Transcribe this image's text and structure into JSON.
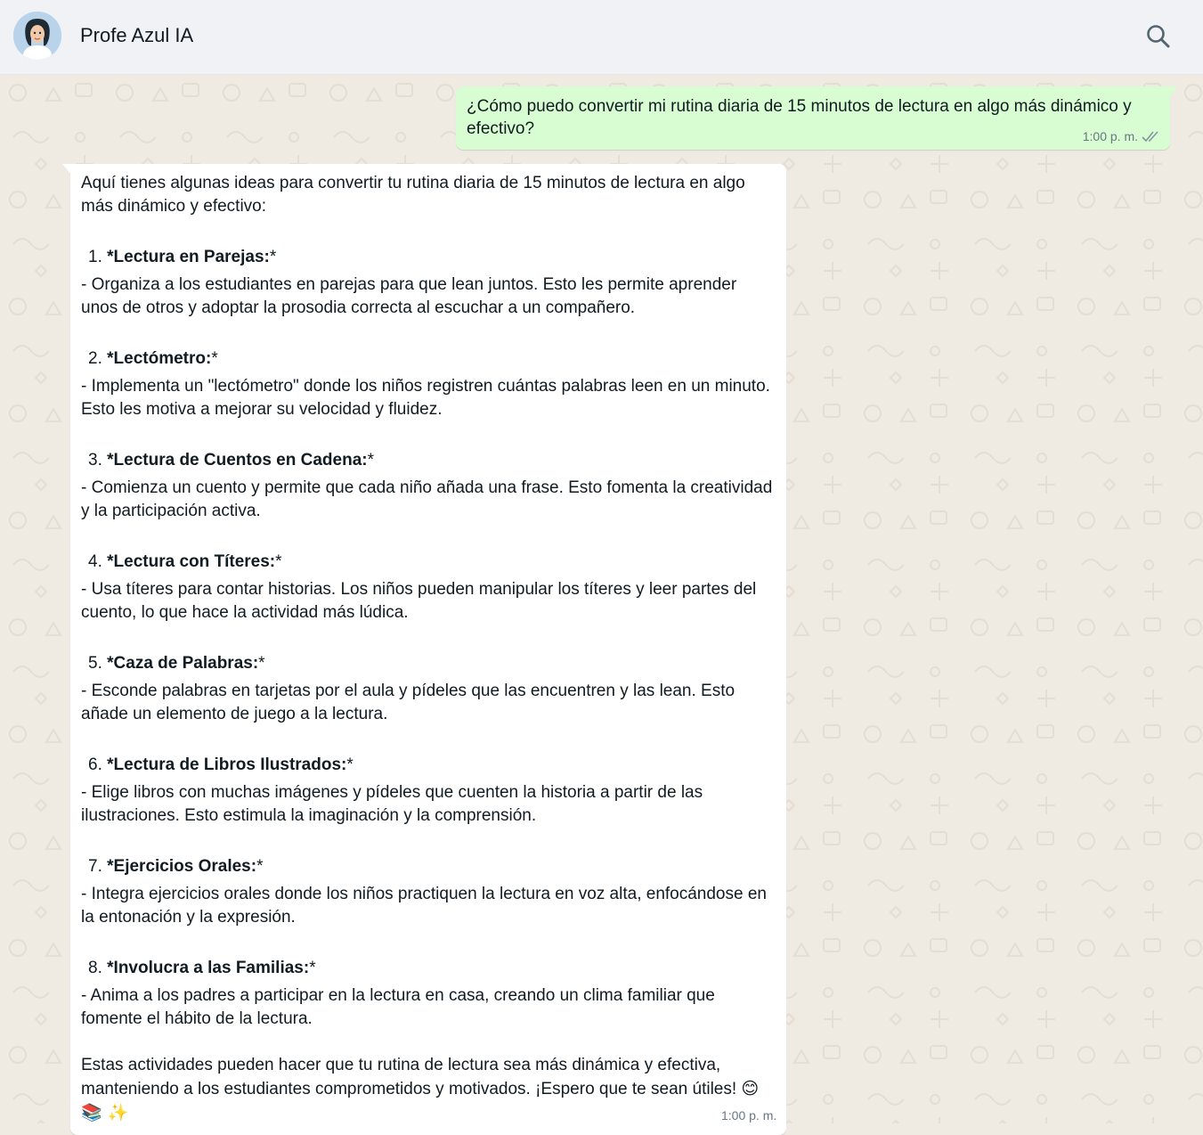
{
  "header": {
    "contact_name": "Profe Azul IA",
    "avatar_icon": "avatar-woman-illustration",
    "search_icon": "search-icon"
  },
  "colors": {
    "header_bg": "#f0f2f5",
    "chat_bg": "#efeae2",
    "outgoing_bubble": "#d9fdd3",
    "incoming_bubble": "#ffffff",
    "text": "#111b21",
    "meta_text": "#667781"
  },
  "messages": {
    "outgoing": {
      "text": "¿Cómo puedo convertir mi rutina diaria de 15 minutos de lectura en algo más dinámico y efectivo?",
      "time": "1:00 p. m.",
      "status_icon": "double-check-icon"
    },
    "incoming": {
      "intro": "Aquí tienes algunas ideas para convertir tu rutina diaria de 15 minutos de lectura en algo más dinámico y efectivo:",
      "items": [
        {
          "num": "1.",
          "title": "*Lectura en Parejas:",
          "tail": "*",
          "desc": "  - Organiza a los estudiantes en parejas para que lean juntos. Esto les permite aprender unos de otros y adoptar la prosodia correcta al escuchar a un compañero."
        },
        {
          "num": "2.",
          "title": "*Lectómetro:",
          "tail": "*",
          "desc": "  - Implementa un \"lectómetro\" donde los niños registren cuántas palabras leen en un minuto. Esto les motiva a mejorar su velocidad y fluidez."
        },
        {
          "num": "3.",
          "title": "*Lectura de Cuentos en Cadena:",
          "tail": "*",
          "desc": "  - Comienza un cuento y permite que cada niño añada una frase. Esto fomenta la creatividad y la participación activa."
        },
        {
          "num": "4.",
          "title": "*Lectura con Títeres:",
          "tail": "*",
          "desc": "  - Usa títeres para contar historias. Los niños pueden manipular los títeres y leer partes del cuento, lo que hace la actividad más lúdica."
        },
        {
          "num": "5.",
          "title": "*Caza de Palabras:",
          "tail": "*",
          "desc": "  - Esconde palabras en tarjetas por el aula y pídeles que las encuentren y las lean. Esto añade un elemento de juego a la lectura."
        },
        {
          "num": "6.",
          "title": "*Lectura de Libros Ilustrados:",
          "tail": "*",
          "desc": "  - Elige libros con muchas imágenes y pídeles que cuenten la historia a partir de las ilustraciones. Esto estimula la imaginación y la comprensión."
        },
        {
          "num": "7.",
          "title": "*Ejercicios Orales:",
          "tail": "*",
          "desc": "  - Integra ejercicios orales donde los niños practiquen la lectura en voz alta, enfocándose en la entonación y la expresión."
        },
        {
          "num": "8.",
          "title": "*Involucra a las Familias:",
          "tail": "*",
          "desc": "  - Anima a los padres a participar en la lectura en casa, creando un clima familiar que fomente el hábito de la lectura."
        }
      ],
      "closing": "Estas actividades pueden hacer que tu rutina de lectura sea más dinámica y efectiva, manteniendo a los estudiantes comprometidos y motivados. ¡Espero que te sean útiles! ",
      "closing_emojis": "😊 📚 ✨",
      "time": "1:00 p. m."
    }
  }
}
